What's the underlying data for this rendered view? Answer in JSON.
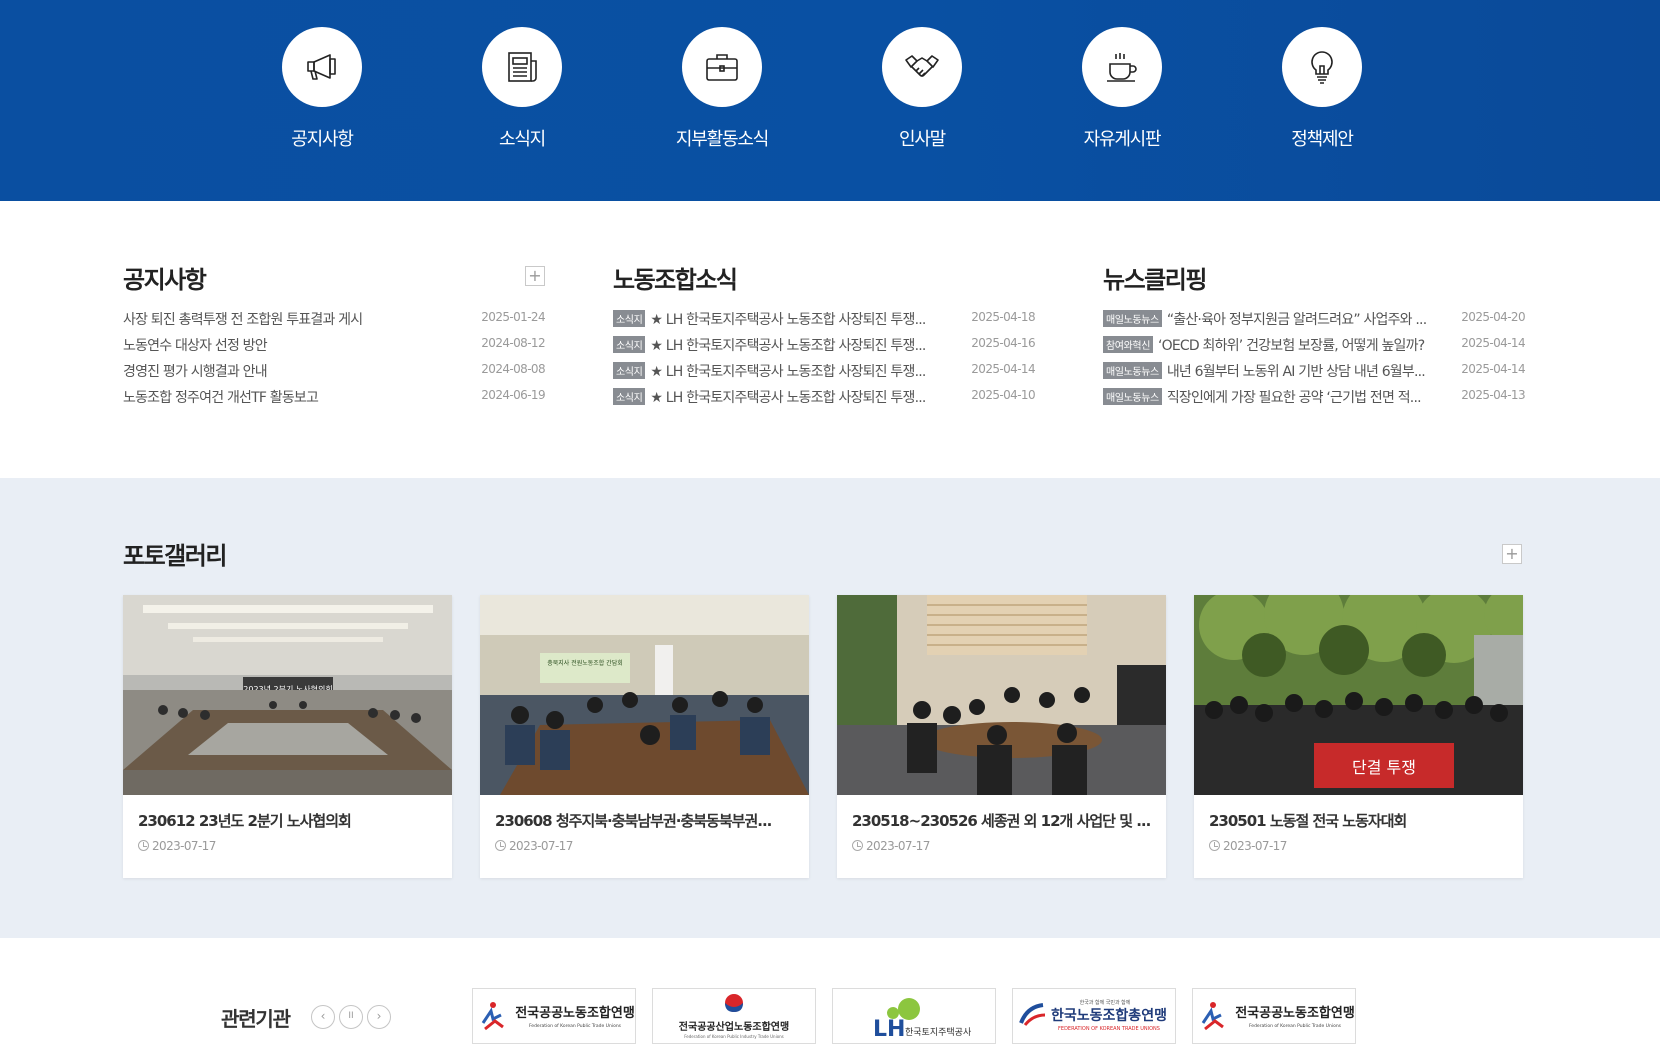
{
  "quick_menu": [
    {
      "label": "공지사항",
      "icon": "megaphone-icon"
    },
    {
      "label": "소식지",
      "icon": "newspaper-icon"
    },
    {
      "label": "지부활동소식",
      "icon": "briefcase-icon"
    },
    {
      "label": "인사말",
      "icon": "handshake-icon"
    },
    {
      "label": "자유게시판",
      "icon": "coffee-cup-icon"
    },
    {
      "label": "정책제안",
      "icon": "lightbulb-icon"
    }
  ],
  "notice": {
    "title": "공지사항",
    "more": "+",
    "posts": [
      {
        "title": "사장 퇴진 총력투쟁 전 조합원 투표결과 게시",
        "date": "2025-01-24"
      },
      {
        "title": "노동연수 대상자 선정 방안",
        "date": "2024-08-12"
      },
      {
        "title": "경영진 평가 시행결과 안내",
        "date": "2024-08-08"
      },
      {
        "title": "노동조합 정주여건 개선TF 활동보고",
        "date": "2024-06-19"
      }
    ]
  },
  "union_news": {
    "title": "노동조합소식",
    "posts": [
      {
        "tag": "소식지",
        "title": "★ LH 한국토지주택공사 노동조합 사장퇴진 투쟁...",
        "date": "2025-04-18"
      },
      {
        "tag": "소식지",
        "title": "★ LH 한국토지주택공사 노동조합 사장퇴진 투쟁...",
        "date": "2025-04-16"
      },
      {
        "tag": "소식지",
        "title": "★ LH 한국토지주택공사 노동조합 사장퇴진 투쟁...",
        "date": "2025-04-14"
      },
      {
        "tag": "소식지",
        "title": "★ LH 한국토지주택공사 노동조합 사장퇴진 투쟁...",
        "date": "2025-04-10"
      }
    ]
  },
  "news_clipping": {
    "title": "뉴스클리핑",
    "posts": [
      {
        "tag": "매일노동뉴스",
        "title": "“출산·육아 정부지원금 알려드려요” 사업주와 ...",
        "date": "2025-04-20"
      },
      {
        "tag": "참여와혁신",
        "title": "‘OECD 최하위’ 건강보험 보장률, 어떻게 높일까?",
        "date": "2025-04-14"
      },
      {
        "tag": "매일노동뉴스",
        "title": "내년 6월부터 노동위 AI 기반 상담 내년 6월부...",
        "date": "2025-04-14"
      },
      {
        "tag": "매일노동뉴스",
        "title": "직장인에게 가장 필요한 공약 ‘근기법 전면 적...",
        "date": "2025-04-13"
      }
    ]
  },
  "gallery": {
    "title": "포토갤러리",
    "more": "+",
    "items": [
      {
        "title": "230612 23년도 2분기 노사협의회",
        "date": "2023-07-17"
      },
      {
        "title": "230608 청주지북·충북남부권·충북동북부권...",
        "date": "2023-07-17"
      },
      {
        "title": "230518~230526 세종권 외 12개 사업단 및 ...",
        "date": "2023-07-17"
      },
      {
        "title": "230501 노동절 전국 노동자대회",
        "date": "2023-07-17"
      }
    ],
    "photo_texts": {
      "banner_1": "2023년 2분기 노사협의회",
      "banner_2": "충북지사 전원노동조합 간담회",
      "banner_4": "단결 투쟁"
    }
  },
  "related": {
    "title": "관련기관",
    "prev": "‹",
    "pause": "II",
    "next": "›",
    "logos": [
      {
        "name": "전국공공노동조합연맹",
        "sub": "Federation of Korean Public Trade Unions"
      },
      {
        "name": "전국공공산업노동조합연맹",
        "sub": "Federation of Korean Public Industry Trade Unions"
      },
      {
        "name": "LH",
        "sub": "한국토지주택공사"
      },
      {
        "name": "한국노동조합총연맹",
        "sub": "FEDERATION OF KOREAN TRADE UNIONS",
        "top": "한국과 함께 국민과 함께"
      },
      {
        "name": "전국공공노동조합연맹",
        "sub": "Federation of Korean Public Trade Unions"
      }
    ]
  },
  "colors": {
    "header_blue": "#0a4fa1",
    "gallery_bg": "#e9eef5",
    "tag_gray": "#888c92"
  }
}
